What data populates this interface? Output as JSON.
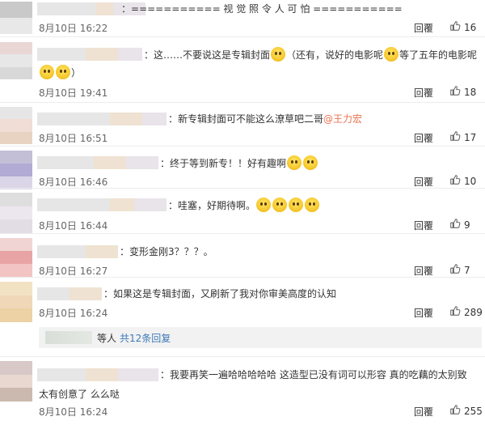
{
  "comments": [
    {
      "text_parts": [
        {
          "t": "：",
          "type": "text"
        }
      ],
      "header": "=========== 视 觉 照 令 人 可 怕 ===========",
      "date": "8月10日 16:22",
      "reply_label": "回覆",
      "likes": "16"
    },
    {
      "line1": [
        {
          "t": "：这……不要说这是专辑封面",
          "type": "text"
        },
        {
          "t": "",
          "type": "emo",
          "name": "laugh-cry-emoji"
        },
        {
          "t": "（还有，说好的电影呢",
          "type": "text"
        },
        {
          "t": "",
          "type": "emo",
          "name": "smile-emoji"
        },
        {
          "t": "等了五年的电影呢",
          "type": "text"
        }
      ],
      "line2": [
        {
          "t": "",
          "type": "emo",
          "name": "sweat-emoji"
        },
        {
          "t": "",
          "type": "emo",
          "name": "sweat-emoji"
        },
        {
          "t": "）",
          "type": "text"
        }
      ],
      "date": "8月10日 19:41",
      "reply_label": "回覆",
      "likes": "18"
    },
    {
      "line1": [
        {
          "t": "：新专辑封面可不能这么潦草吧二哥",
          "type": "text"
        },
        {
          "t": "@王力宏",
          "type": "mention"
        }
      ],
      "date": "8月10日 16:51",
      "reply_label": "回覆",
      "likes": "17"
    },
    {
      "line1": [
        {
          "t": "：终于等到新专！！好有趣啊",
          "type": "text"
        },
        {
          "t": "",
          "type": "emo",
          "name": "surprised-emoji"
        },
        {
          "t": "",
          "type": "emo",
          "name": "surprised-emoji"
        }
      ],
      "date": "8月10日 16:46",
      "reply_label": "回覆",
      "likes": "10"
    },
    {
      "line1": [
        {
          "t": "：哇塞，好期待啊。",
          "type": "text"
        },
        {
          "t": "",
          "type": "emo",
          "name": "wow-emoji"
        },
        {
          "t": "",
          "type": "emo",
          "name": "wow-emoji"
        },
        {
          "t": "",
          "type": "emo",
          "name": "wow-emoji"
        },
        {
          "t": "",
          "type": "emo",
          "name": "wow-emoji"
        }
      ],
      "date": "8月10日 16:44",
      "reply_label": "回覆",
      "likes": "9"
    },
    {
      "line1": [
        {
          "t": "：变形金刚3？？？。",
          "type": "text"
        }
      ],
      "date": "8月10日 16:27",
      "reply_label": "回覆",
      "likes": "7"
    },
    {
      "line1": [
        {
          "t": "：如果这是专辑封面，又刷新了我对你审美高度的认知",
          "type": "text"
        }
      ],
      "date": "8月10日 16:24",
      "reply_label": "回覆",
      "likes": "289",
      "sub_reply": {
        "prefix": "等人",
        "link": "共12条回复"
      }
    },
    {
      "line1": [
        {
          "t": "：我要再笑一遍哈哈哈哈哈 这造型已没有词可以形容 真的吃藕的太别致",
          "type": "text"
        }
      ],
      "line2": [
        {
          "t": "太有创意了 么么哒",
          "type": "text"
        }
      ],
      "date": "8月10日 16:24",
      "reply_label": "回覆",
      "likes": "255"
    }
  ],
  "colors": {
    "mention": "#eb7350",
    "link": "#3d7ab8",
    "divider": "#ececec",
    "reply_box_bg": "#f2f2f2"
  },
  "icons": {
    "like": "thumbs-up-icon"
  }
}
